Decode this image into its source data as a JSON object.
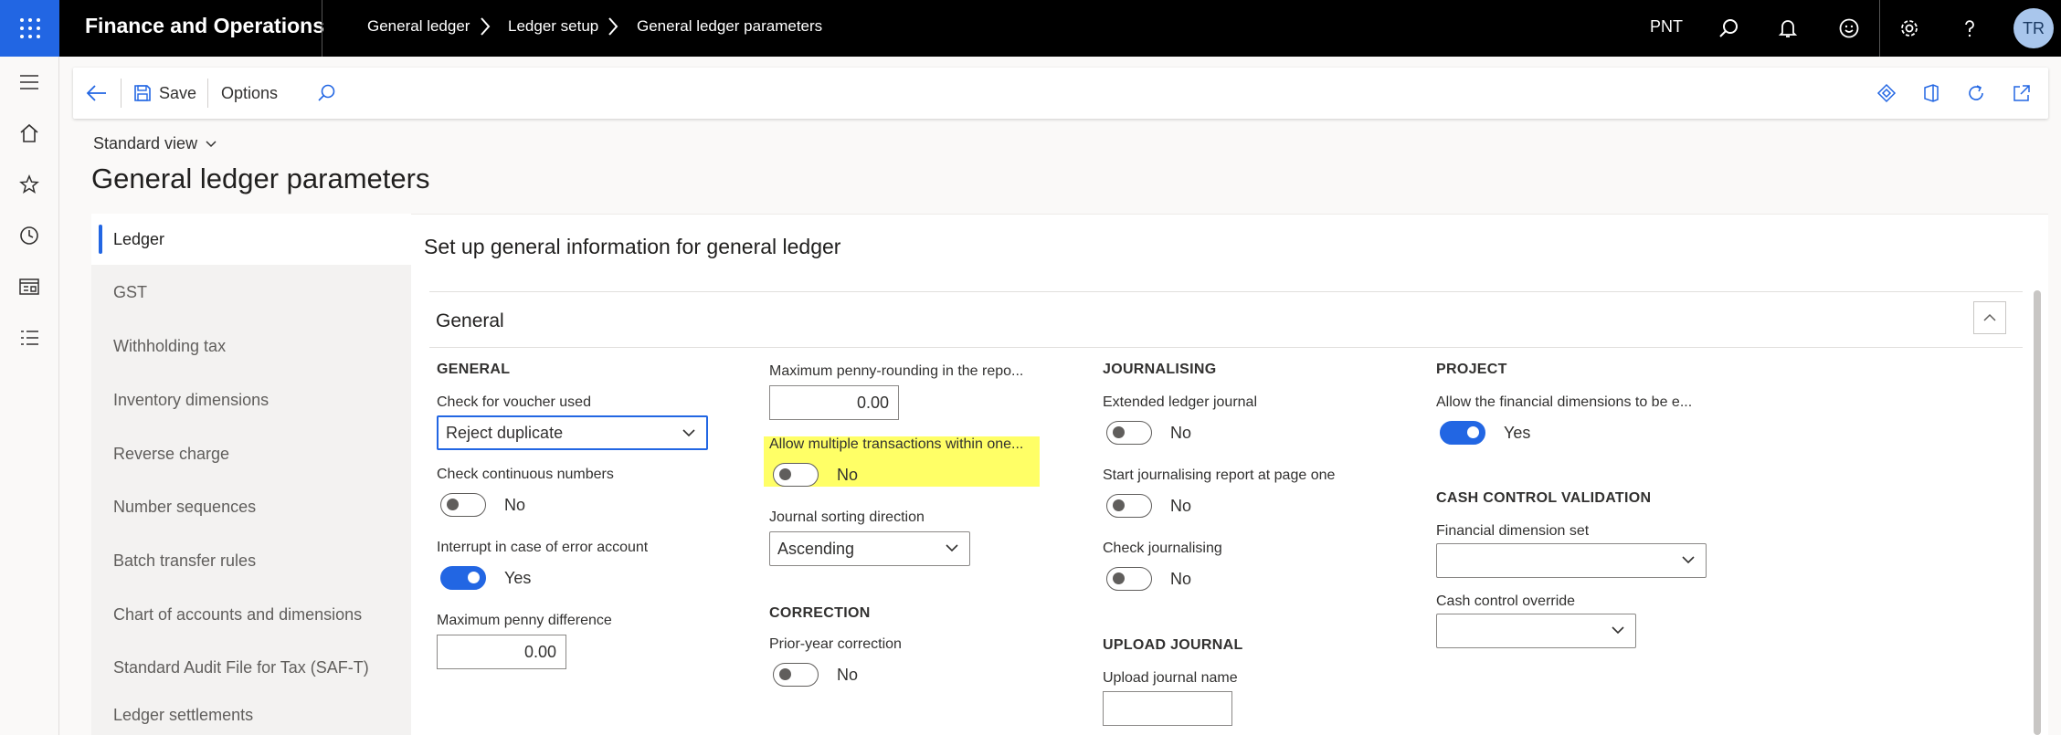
{
  "topbar": {
    "app_title": "Finance and Operations",
    "breadcrumb": [
      "General ledger",
      "Ledger setup",
      "General ledger parameters"
    ],
    "company": "PNT",
    "avatar_initials": "TR",
    "waffle_icon": "waffle-icon",
    "icons": [
      "search-icon",
      "bell-icon",
      "smiley-icon",
      "gear-icon",
      "help-icon"
    ]
  },
  "actionpane": {
    "save_label": "Save",
    "options_label": "Options"
  },
  "standard_view": "Standard view",
  "page_title": "General ledger parameters",
  "tabs": [
    "Ledger",
    "GST",
    "Withholding tax",
    "Inventory dimensions",
    "Reverse charge",
    "Number sequences",
    "Batch transfer rules",
    "Chart of accounts and dimensions",
    "Standard Audit File for Tax (SAF-T)",
    "Ledger settlements"
  ],
  "content_title": "Set up general information for general ledger",
  "fasttab_title": "General",
  "col1": {
    "group": "GENERAL",
    "voucher_label": "Check for voucher used",
    "voucher_value": "Reject duplicate",
    "continuous_label": "Check continuous numbers",
    "continuous_value": "No",
    "interrupt_label": "Interrupt in case of error account",
    "interrupt_value": "Yes",
    "penny_diff_label": "Maximum penny difference",
    "penny_diff_value": "0.00"
  },
  "col2": {
    "penny_round_label": "Maximum penny-rounding in the repo...",
    "penny_round_value": "0.00",
    "allow_multi_label": "Allow multiple transactions within one...",
    "allow_multi_value": "No",
    "sort_dir_label": "Journal sorting direction",
    "sort_dir_value": "Ascending",
    "correction_group": "CORRECTION",
    "prior_year_label": "Prior-year correction",
    "prior_year_value": "No"
  },
  "col3": {
    "group": "JOURNALISING",
    "extended_label": "Extended ledger journal",
    "extended_value": "No",
    "start_page_label": "Start journalising report at page one",
    "start_page_value": "No",
    "check_journal_label": "Check journalising",
    "check_journal_value": "No",
    "upload_group": "UPLOAD JOURNAL",
    "upload_name_label": "Upload journal name",
    "upload_name_value": ""
  },
  "col4": {
    "group": "PROJECT",
    "allow_fin_label": "Allow the financial dimensions to be e...",
    "allow_fin_value": "Yes",
    "cash_group": "CASH CONTROL VALIDATION",
    "fin_dim_set_label": "Financial dimension set",
    "fin_dim_set_value": "",
    "cash_override_label": "Cash control override",
    "cash_override_value": ""
  },
  "colors": {
    "accent": "#2266e3",
    "highlight": "#ffff66",
    "topbar": "#000000"
  }
}
